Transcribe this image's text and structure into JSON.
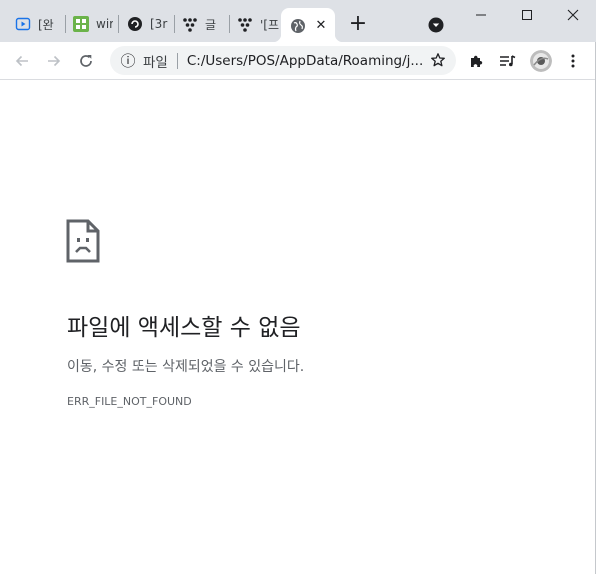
{
  "tabs": [
    {
      "title": "[완",
      "icon": "video-icon"
    },
    {
      "title": "wir",
      "icon": "grid-app-icon"
    },
    {
      "title": "[3r",
      "icon": "round-logo-icon"
    },
    {
      "title": "글",
      "icon": "dots-logo-icon"
    },
    {
      "title": "'[프",
      "icon": "dots-logo-icon"
    }
  ],
  "active_tab": {
    "icon": "globe-icon",
    "close": "✕"
  },
  "new_tab": "+",
  "address_bar": {
    "info": "ⓘ",
    "scheme": "파일",
    "url": "C:/Users/POS/AppData/Roaming/j..."
  },
  "error": {
    "title": "파일에 액세스할 수 없음",
    "message": "이동, 수정 또는 삭제되었을 수 있습니다.",
    "code": "ERR_FILE_NOT_FOUND"
  },
  "colors": {
    "titlebar": "#dee1e6",
    "omnibox": "#f1f3f4",
    "text": "#202124",
    "muted": "#5f6368"
  }
}
